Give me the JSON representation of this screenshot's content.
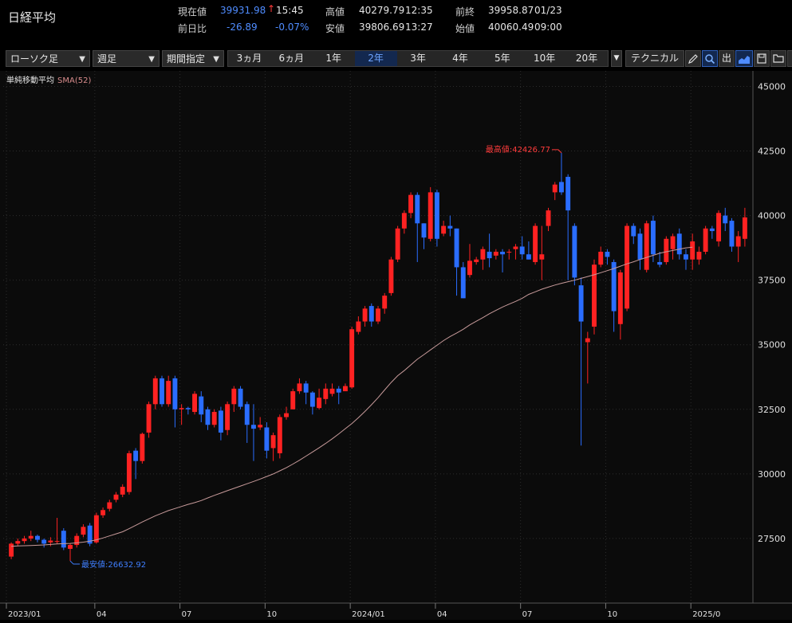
{
  "header": {
    "title": "日経平均",
    "current_label": "現在値",
    "current_value": "39931.98",
    "current_arrow": "↑",
    "current_time": "15:45",
    "high_label": "高値",
    "high_value": "40279.79",
    "high_time": "12:35",
    "prev_close_label": "前終",
    "prev_close_value": "39958.87",
    "prev_close_date": "01/23",
    "change_label": "前日比",
    "change_value": "-26.89",
    "change_pct": "-0.07%",
    "low_label": "安値",
    "low_value": "39806.69",
    "low_time": "13:27",
    "open_label": "始値",
    "open_value": "40060.49",
    "open_time": "09:00"
  },
  "toolbar": {
    "chart_type": "ローソク足",
    "interval": "週足",
    "period_select": "期間指定",
    "periods": [
      "3ヵ月",
      "6ヵ月",
      "1年",
      "2年",
      "3年",
      "4年",
      "5年",
      "10年",
      "20年"
    ],
    "active_period": "2年",
    "technical": "テクニカル"
  },
  "legend": {
    "indicator": "単純移動平均",
    "sma": "SMA(52)"
  },
  "colors": {
    "up": "#ff2222",
    "down": "#2a6dff",
    "sma": "#c79a9a",
    "grid": "#2c2c2c",
    "max_label": "#ff3b3b",
    "min_label": "#3f7fff"
  },
  "chart_data": {
    "type": "candlestick",
    "ylim": [
      25000,
      45600
    ],
    "y_ticks": [
      27500,
      30000,
      32500,
      35000,
      37500,
      40000,
      42500,
      45000
    ],
    "x_ticks": [
      "2023/01",
      "04",
      "07",
      "10",
      "2024/01",
      "04",
      "07",
      "10",
      "2025/0"
    ],
    "max_label": "最高値:42426.77",
    "min_label": "最安値:26632.92",
    "max": 42426.77,
    "min": 26632.92,
    "candles": [
      [
        26800,
        27300,
        26700,
        27350
      ],
      [
        27300,
        27400,
        27200,
        27500
      ],
      [
        27400,
        27500,
        27300,
        27600
      ],
      [
        27500,
        27600,
        27400,
        27800
      ],
      [
        27600,
        27450,
        27350,
        27650
      ],
      [
        27450,
        27300,
        27150,
        27500
      ],
      [
        27350,
        27420,
        27200,
        27550
      ],
      [
        27400,
        27400,
        27300,
        28300
      ],
      [
        27800,
        27150,
        27050,
        27900
      ],
      [
        27100,
        27250,
        26632.92,
        27300
      ],
      [
        27250,
        27600,
        27150,
        27700
      ],
      [
        27650,
        27950,
        27550,
        28050
      ],
      [
        28000,
        27300,
        27200,
        28100
      ],
      [
        27350,
        28400,
        27300,
        28500
      ],
      [
        28400,
        28600,
        28300,
        28700
      ],
      [
        28650,
        28900,
        28550,
        29000
      ],
      [
        29000,
        29200,
        28900,
        29300
      ],
      [
        29200,
        29500,
        29100,
        29600
      ],
      [
        29300,
        30800,
        29200,
        30900
      ],
      [
        30900,
        30500,
        29800,
        31000
      ],
      [
        30500,
        31550,
        30400,
        31600
      ],
      [
        31600,
        32700,
        31400,
        32800
      ],
      [
        32700,
        33700,
        32500,
        33800
      ],
      [
        33700,
        32700,
        32600,
        33800
      ],
      [
        32700,
        33600,
        32600,
        33800
      ],
      [
        33700,
        32500,
        31800,
        33800
      ],
      [
        32500,
        32550,
        31900,
        32700
      ],
      [
        32550,
        32500,
        32300,
        32600
      ],
      [
        32400,
        33100,
        32300,
        33200
      ],
      [
        33000,
        32300,
        32000,
        33200
      ],
      [
        32500,
        31900,
        31700,
        32600
      ],
      [
        31900,
        32400,
        31800,
        32500
      ],
      [
        32450,
        31600,
        31300,
        32600
      ],
      [
        31700,
        32700,
        31500,
        32800
      ],
      [
        32700,
        33300,
        32400,
        33400
      ],
      [
        33300,
        32600,
        32500,
        33400
      ],
      [
        32700,
        31900,
        31200,
        32800
      ],
      [
        31900,
        31750,
        30500,
        32700
      ],
      [
        31800,
        31900,
        31700,
        32200
      ],
      [
        31800,
        30900,
        30600,
        32000
      ],
      [
        31000,
        31500,
        30500,
        31600
      ],
      [
        30800,
        32200,
        30600,
        32300
      ],
      [
        32200,
        32350,
        32100,
        32600
      ],
      [
        32500,
        33200,
        32500,
        33300
      ],
      [
        33200,
        33500,
        33100,
        33700
      ],
      [
        33500,
        33150,
        32700,
        33600
      ],
      [
        33150,
        32600,
        32300,
        33200
      ],
      [
        32550,
        32950,
        32500,
        33300
      ],
      [
        32900,
        33300,
        32700,
        33500
      ],
      [
        33100,
        33300,
        33000,
        33500
      ],
      [
        33300,
        33150,
        32700,
        33400
      ],
      [
        33200,
        33400,
        33300,
        33500
      ],
      [
        33350,
        35600,
        33300,
        35700
      ],
      [
        35500,
        35900,
        35400,
        36100
      ],
      [
        35900,
        36400,
        35700,
        36500
      ],
      [
        36500,
        35900,
        35700,
        36600
      ],
      [
        35900,
        36400,
        35800,
        36500
      ],
      [
        36400,
        36900,
        36200,
        37000
      ],
      [
        37000,
        38300,
        36900,
        38400
      ],
      [
        38300,
        39500,
        38200,
        39600
      ],
      [
        39500,
        40100,
        39300,
        40200
      ],
      [
        40100,
        40800,
        39900,
        40900
      ],
      [
        40800,
        39700,
        38200,
        40900
      ],
      [
        39700,
        39150,
        38700,
        39700
      ],
      [
        39100,
        40900,
        39000,
        41100
      ],
      [
        40900,
        39100,
        38800,
        41000
      ],
      [
        39300,
        39600,
        39200,
        39800
      ],
      [
        39600,
        39500,
        39200,
        40000
      ],
      [
        39500,
        38000,
        36900,
        39500
      ],
      [
        38000,
        36800,
        36800,
        38200
      ],
      [
        37700,
        38250,
        37600,
        38900
      ],
      [
        38200,
        38300,
        38100,
        38400
      ],
      [
        38300,
        38700,
        37900,
        38800
      ],
      [
        38600,
        38350,
        38000,
        39300
      ],
      [
        38450,
        38600,
        38300,
        38700
      ],
      [
        38600,
        38500,
        37800,
        38700
      ],
      [
        38600,
        38600,
        38300,
        38700
      ],
      [
        38700,
        38800,
        38300,
        38900
      ],
      [
        38800,
        38500,
        38300,
        39200
      ],
      [
        38500,
        38300,
        38300,
        39000
      ],
      [
        38200,
        39600,
        38100,
        39700
      ],
      [
        38300,
        38500,
        37500,
        39600
      ],
      [
        39600,
        40200,
        39400,
        40300
      ],
      [
        40900,
        41200,
        40600,
        41300
      ],
      [
        41300,
        40900,
        40800,
        42426.77
      ],
      [
        41500,
        40200,
        37500,
        41600
      ],
      [
        39600,
        37600,
        37300,
        39700
      ],
      [
        37300,
        35900,
        31100,
        37600
      ],
      [
        35100,
        35250,
        33500,
        35500
      ],
      [
        35700,
        38100,
        35400,
        38300
      ],
      [
        38100,
        38600,
        38000,
        38800
      ],
      [
        38600,
        38400,
        38100,
        38700
      ],
      [
        38200,
        36300,
        35500,
        38300
      ],
      [
        35800,
        37800,
        35200,
        37900
      ],
      [
        36400,
        39600,
        36300,
        39700
      ],
      [
        39600,
        39200,
        38900,
        39700
      ],
      [
        39300,
        38300,
        37900,
        39500
      ],
      [
        37900,
        39700,
        37800,
        39800
      ],
      [
        39800,
        38500,
        38200,
        40000
      ],
      [
        38200,
        38100,
        38000,
        38600
      ],
      [
        38200,
        39100,
        38100,
        39200
      ],
      [
        38700,
        39200,
        38300,
        39300
      ],
      [
        39300,
        38500,
        38300,
        39500
      ],
      [
        38500,
        38300,
        37900,
        38700
      ],
      [
        38300,
        39000,
        37900,
        39300
      ],
      [
        38300,
        38600,
        38100,
        38800
      ],
      [
        38600,
        39500,
        38500,
        39600
      ],
      [
        39500,
        39400,
        39100,
        39600
      ],
      [
        39000,
        40100,
        38800,
        40200
      ],
      [
        40000,
        39700,
        39400,
        40300
      ],
      [
        39800,
        38800,
        38600,
        39900
      ],
      [
        38800,
        39200,
        38200,
        39400
      ],
      [
        39100,
        39930,
        38800,
        40300
      ]
    ],
    "sma52": [
      27200,
      27210,
      27220,
      27230,
      27240,
      27250,
      27270,
      27290,
      27300,
      27310,
      27330,
      27360,
      27400,
      27450,
      27520,
      27600,
      27680,
      27760,
      27880,
      28010,
      28140,
      28260,
      28380,
      28480,
      28580,
      28660,
      28740,
      28820,
      28890,
      28970,
      29070,
      29170,
      29260,
      29350,
      29440,
      29530,
      29620,
      29710,
      29800,
      29900,
      30000,
      30120,
      30240,
      30380,
      30530,
      30690,
      30850,
      31010,
      31180,
      31360,
      31550,
      31750,
      31950,
      32180,
      32420,
      32680,
      32950,
      33250,
      33540,
      33800,
      34000,
      34220,
      34440,
      34620,
      34800,
      34980,
      35160,
      35320,
      35450,
      35600,
      35770,
      35910,
      36050,
      36200,
      36330,
      36460,
      36570,
      36680,
      36800,
      36950,
      37050,
      37150,
      37230,
      37310,
      37380,
      37440,
      37500,
      37570,
      37640,
      37710,
      37790,
      37870,
      37950,
      38040,
      38130,
      38210,
      38300,
      38380,
      38460,
      38540,
      38600,
      38650,
      38700,
      38750,
      38780
    ]
  }
}
